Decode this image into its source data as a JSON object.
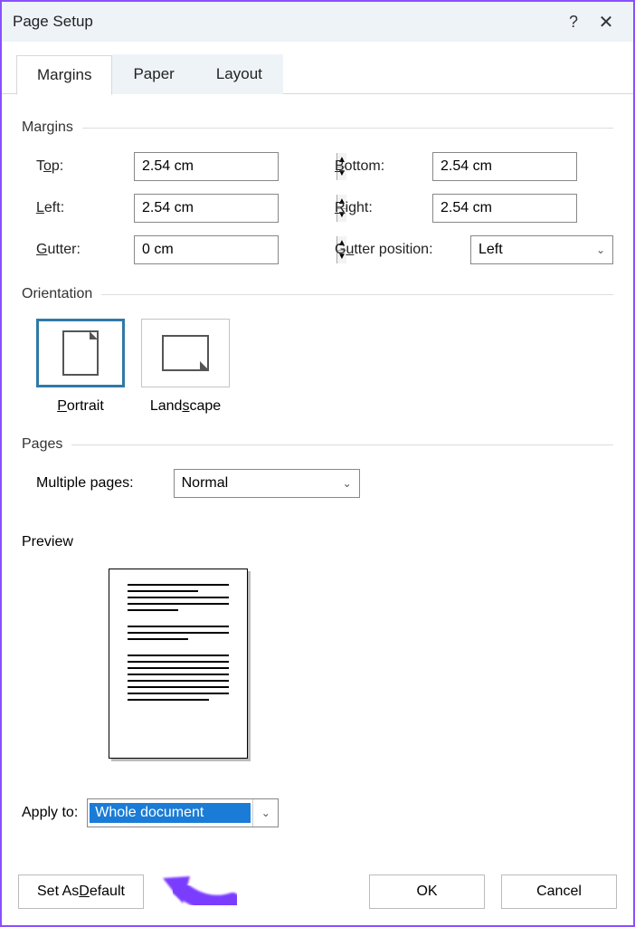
{
  "title": "Page Setup",
  "tabs": {
    "margins": "Margins",
    "paper": "Paper",
    "layout": "Layout"
  },
  "sections": {
    "margins": "Margins",
    "orientation": "Orientation",
    "pages": "Pages",
    "preview": "Preview"
  },
  "margins": {
    "top": {
      "label_pre": "T",
      "label_u": "o",
      "label_post": "p:",
      "value": "2.54 cm"
    },
    "bottom": {
      "label_pre": "",
      "label_u": "B",
      "label_post": "ottom:",
      "value": "2.54 cm"
    },
    "left": {
      "label_pre": "",
      "label_u": "L",
      "label_post": "eft:",
      "value": "2.54 cm"
    },
    "right": {
      "label_pre": "",
      "label_u": "R",
      "label_post": "ight:",
      "value": "2.54 cm"
    },
    "gutter": {
      "label_pre": "",
      "label_u": "G",
      "label_post": "utter:",
      "value": "0 cm"
    },
    "gutter_pos": {
      "label_pre": "G",
      "label_u": "u",
      "label_post": "tter position:",
      "value": "Left"
    }
  },
  "orientation": {
    "portrait": {
      "label_pre": "",
      "label_u": "P",
      "label_post": "ortrait"
    },
    "landscape": {
      "label_pre": "Land",
      "label_u": "s",
      "label_post": "cape"
    }
  },
  "pages": {
    "multiple_label_pre": "",
    "multiple_label_u": "M",
    "multiple_label_post": "ultiple pages:",
    "multiple_value": "Normal"
  },
  "apply": {
    "label_pre": "Appl",
    "label_u": "y",
    "label_post": " to:",
    "value": "Whole document"
  },
  "buttons": {
    "default_pre": "Set As ",
    "default_u": "D",
    "default_post": "efault",
    "ok": "OK",
    "cancel": "Cancel"
  }
}
